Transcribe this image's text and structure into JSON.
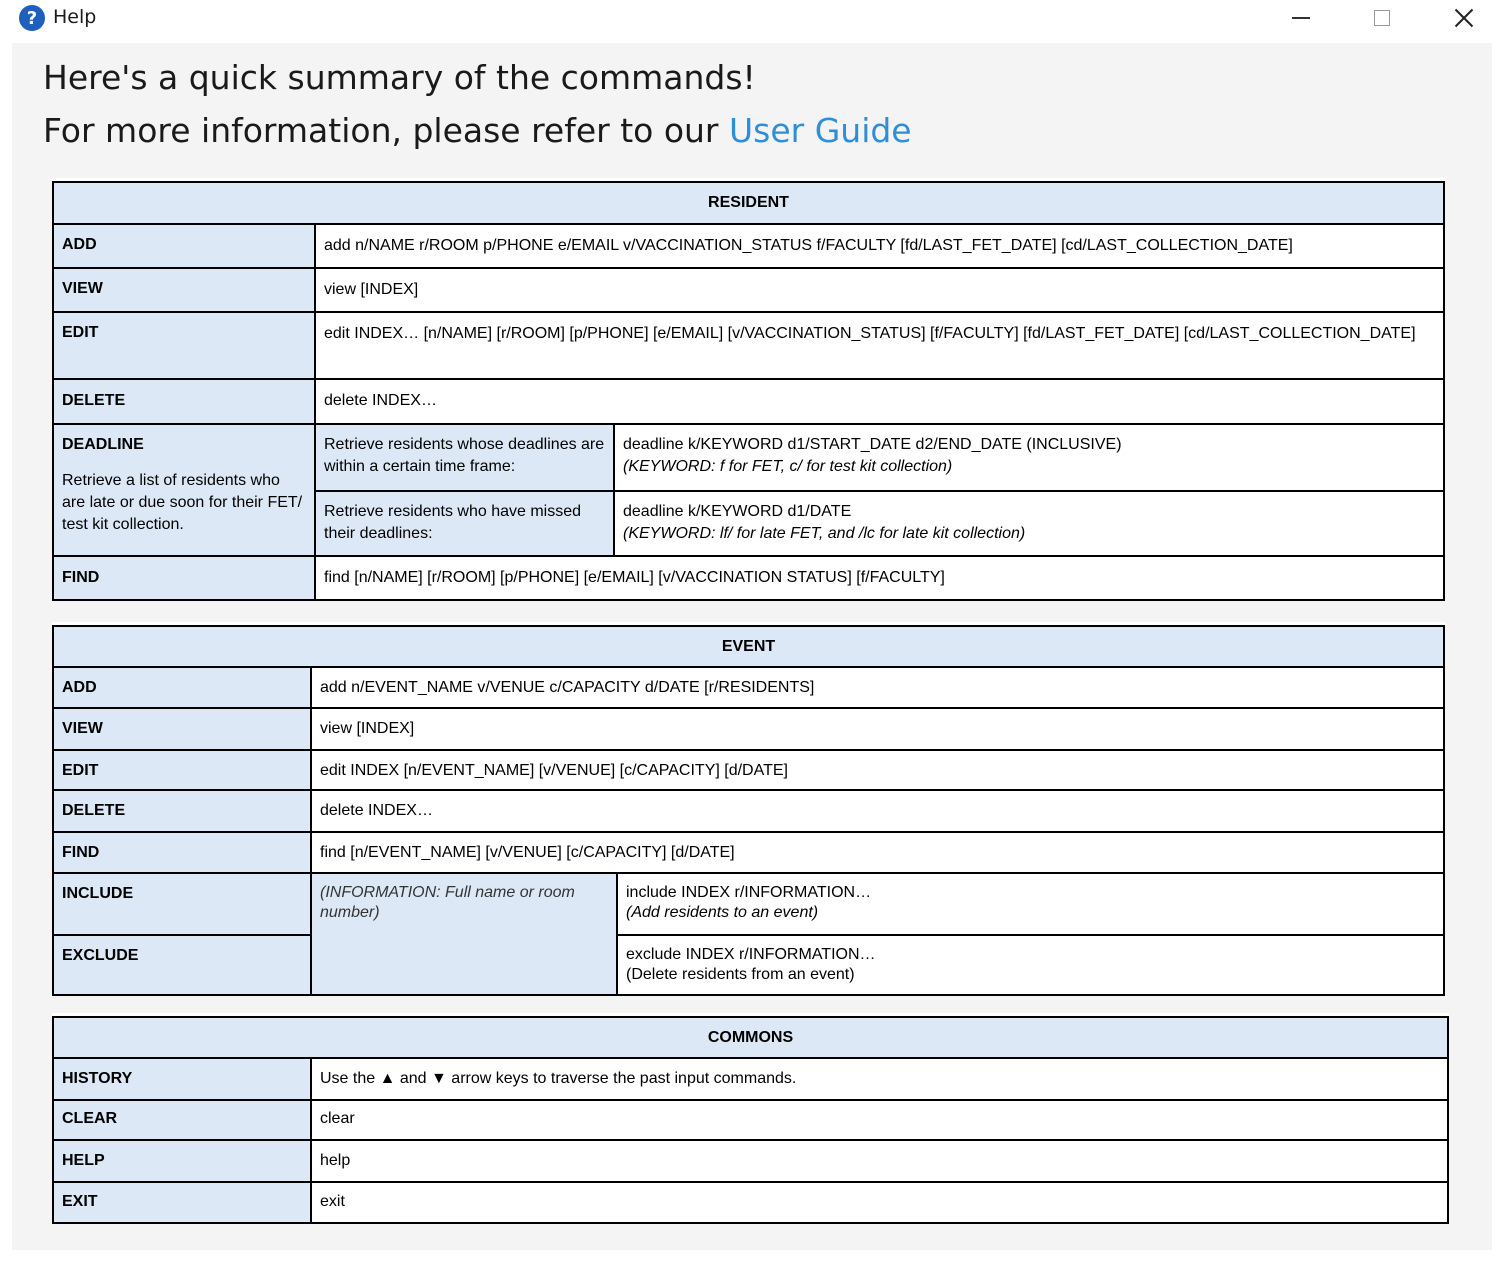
{
  "window": {
    "title": "Help",
    "icon": "help-icon",
    "controls": {
      "minimize": "minimize-icon",
      "maximize": "maximize-icon",
      "close": "close-icon"
    }
  },
  "intro": {
    "line1": "Here's a quick summary of the commands!",
    "line2_prefix": "For more information, please refer to our ",
    "user_guide_link": "User Guide",
    "link_color": "#2f8fd6"
  },
  "resident": {
    "header": "RESIDENT",
    "add": {
      "label": "ADD",
      "command": "add n/NAME r/ROOM p/PHONE e/EMAIL v/VACCINATION_STATUS f/FACULTY [fd/LAST_FET_DATE] [cd/LAST_COLLECTION_DATE]"
    },
    "view": {
      "label": "VIEW",
      "command": "view [INDEX]"
    },
    "edit": {
      "label": "EDIT",
      "command": "edit INDEX… [n/NAME] [r/ROOM] [p/PHONE] [e/EMAIL] [v/VACCINATION_STATUS] [f/FACULTY] [fd/LAST_FET_DATE] [cd/LAST_COLLECTION_DATE]"
    },
    "delete": {
      "label": "DELETE",
      "command": "delete INDEX…"
    },
    "deadline": {
      "label": "DEADLINE",
      "description": "Retrieve a list of residents who are late or due soon for their FET/ test kit collection.",
      "within": {
        "label": "Retrieve residents whose deadlines are within a certain time frame:",
        "command": "deadline k/KEYWORD d1/START_DATE d2/END_DATE (INCLUSIVE)",
        "note": "(KEYWORD: f for FET, c/ for test kit collection)"
      },
      "missed": {
        "label": "Retrieve residents who have missed their deadlines:",
        "command": "deadline k/KEYWORD d1/DATE",
        "note": "(KEYWORD: lf/ for late FET, and /lc for late kit collection)"
      }
    },
    "find": {
      "label": "FIND",
      "command": "find [n/NAME] [r/ROOM] [p/PHONE] [e/EMAIL] [v/VACCINATION STATUS] [f/FACULTY]"
    }
  },
  "event": {
    "header": "EVENT",
    "add": {
      "label": "ADD",
      "command": "add n/EVENT_NAME v/VENUE c/CAPACITY d/DATE [r/RESIDENTS]"
    },
    "view": {
      "label": "VIEW",
      "command": "view [INDEX]"
    },
    "edit": {
      "label": "EDIT",
      "command": "edit INDEX [n/EVENT_NAME] [v/VENUE] [c/CAPACITY] [d/DATE]"
    },
    "delete": {
      "label": "DELETE",
      "command": "delete INDEX…"
    },
    "find": {
      "label": "FIND",
      "command": "find [n/EVENT_NAME] [v/VENUE] [c/CAPACITY] [d/DATE]"
    },
    "info_note": "(INFORMATION: Full name or room number)",
    "include": {
      "label": "INCLUDE",
      "command": "include INDEX r/INFORMATION…",
      "note": "(Add residents to an event)"
    },
    "exclude": {
      "label": "EXCLUDE",
      "command": "exclude INDEX r/INFORMATION…",
      "note": "(Delete residents from an event)"
    }
  },
  "commons": {
    "header": "COMMONS",
    "history": {
      "label": "HISTORY",
      "command": "Use the ▲ and ▼ arrow keys to traverse the past input commands."
    },
    "clear": {
      "label": "CLEAR",
      "command": "clear"
    },
    "help": {
      "label": "HELP",
      "command": "help"
    },
    "exit": {
      "label": "EXIT",
      "command": "exit"
    }
  }
}
